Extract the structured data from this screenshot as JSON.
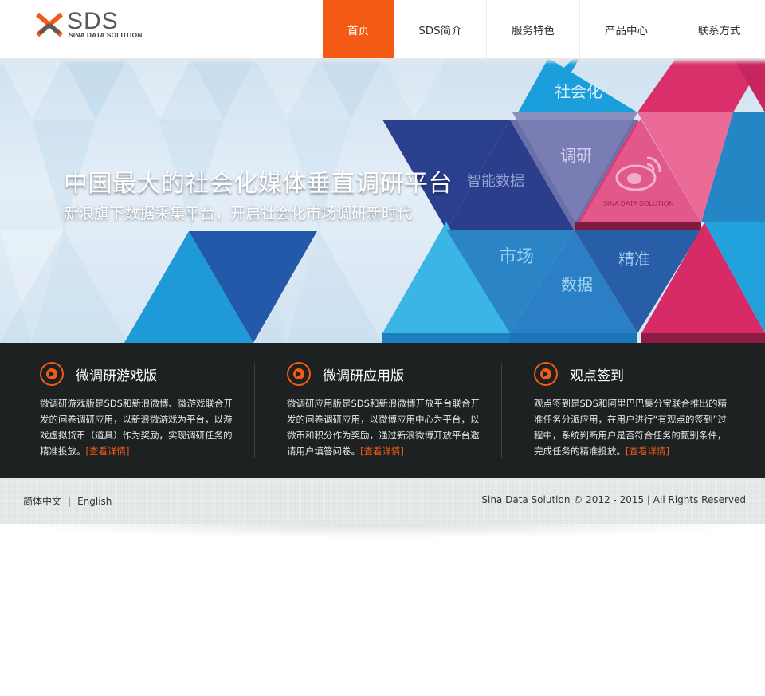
{
  "brand": {
    "logo_text": "SDS",
    "logo_subtitle": "SINA DATA SOLUTION",
    "accent_color": "#f35b14"
  },
  "nav": {
    "items": [
      {
        "label": "首页",
        "active": true
      },
      {
        "label": "SDS简介",
        "active": false
      },
      {
        "label": "服务特色",
        "active": false
      },
      {
        "label": "产品中心",
        "active": false
      },
      {
        "label": "联系方式",
        "active": false
      }
    ]
  },
  "banner": {
    "title": "中国最大的社会化媒体垂直调研平台",
    "subtitle": "新浪旗下数据采集平台，开启社会化市场调研新时代",
    "tags": {
      "social": "社会化",
      "research": "调研",
      "smart_data": "智能数据",
      "market": "市场",
      "precise": "精准",
      "data": "数据"
    },
    "weibo_caption": "SINA DATA SOLUTION"
  },
  "features": [
    {
      "icon": "arrow-right-circle-icon",
      "title": "微调研游戏版",
      "description": "微调研游戏版是SDS和新浪微博、微游戏联合开发的问卷调研应用，以新浪微游戏为平台，以游戏虚拟货币（道具）作为奖励，实现调研任务的精准投放。",
      "link": "[查看详情]"
    },
    {
      "icon": "arrow-right-circle-icon",
      "title": "微调研应用版",
      "description": "微调研应用版是SDS和新浪微博开放平台联合开发的问卷调研应用，以微博应用中心为平台，以微币和积分作为奖励，通过新浪微博开放平台邀请用户填答问卷。",
      "link": "[查看详情]"
    },
    {
      "icon": "arrow-right-circle-icon",
      "title": "观点签到",
      "description": "观点签到是SDS和阿里巴巴集分宝联合推出的精准任务分派应用，在用户进行“有观点的签到”过程中，系统判断用户是否符合任务的甄别条件，完成任务的精准投放。",
      "link": "[查看详情]"
    }
  ],
  "footer": {
    "lang_cn": "简体中文",
    "separator": "|",
    "lang_en": "English",
    "copyright": "Sina Data Solution © 2012 - 2015 | All Rights Reserved"
  }
}
